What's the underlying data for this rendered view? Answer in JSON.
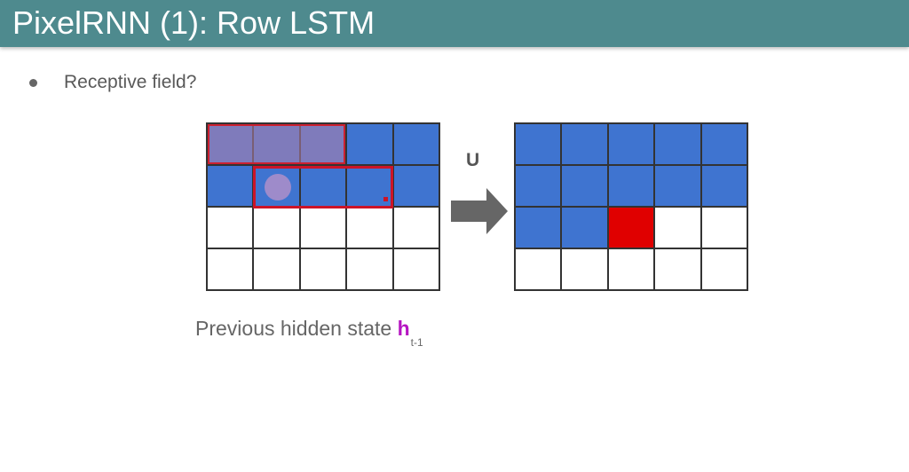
{
  "slide": {
    "title": "PixelRNN (1): Row LSTM",
    "bullet": "Receptive field?"
  },
  "diagram": {
    "arrow_label": "U",
    "caption_text": "Previous hidden state ",
    "caption_symbol": "h",
    "caption_subscript": "t-1",
    "left_grid": {
      "rows": 4,
      "cols": 5,
      "cells": [
        [
          "blue",
          "blue",
          "blue",
          "blue",
          "blue"
        ],
        [
          "blue",
          "blue",
          "blue",
          "blue",
          "blue"
        ],
        [
          "white",
          "white",
          "white",
          "white",
          "white"
        ],
        [
          "white",
          "white",
          "white",
          "white",
          "white"
        ]
      ]
    },
    "right_grid": {
      "rows": 4,
      "cols": 5,
      "cells": [
        [
          "blue",
          "blue",
          "blue",
          "blue",
          "blue"
        ],
        [
          "blue",
          "blue",
          "blue",
          "blue",
          "blue"
        ],
        [
          "blue",
          "blue",
          "red",
          "white",
          "white"
        ],
        [
          "white",
          "white",
          "white",
          "white",
          "white"
        ]
      ]
    },
    "colors": {
      "title_bar": "#4e8a8e",
      "blue": "#3f74d0",
      "red": "#e00000",
      "highlight_border": "#cc1428",
      "symbol": "#b616c2"
    }
  }
}
